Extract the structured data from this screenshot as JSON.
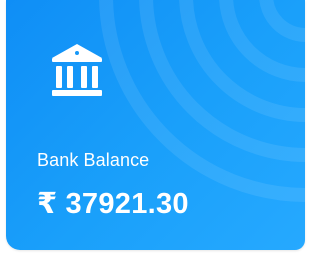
{
  "card": {
    "icon": "bank-icon",
    "label": "Bank Balance",
    "currency_symbol": "₹",
    "amount": "37921.30",
    "colors": {
      "card_gradient_start": "#0f8ef6",
      "card_gradient_end": "#26a9ff",
      "text": "#ffffff"
    }
  }
}
